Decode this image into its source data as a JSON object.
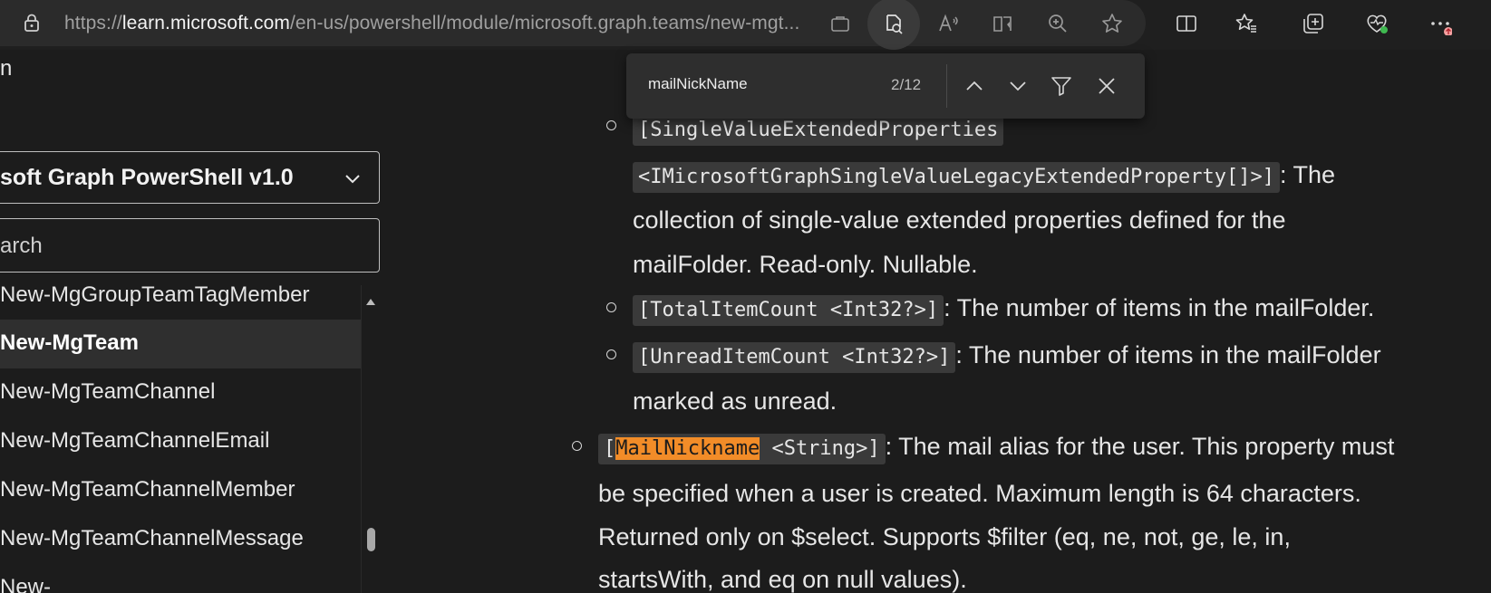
{
  "browser": {
    "url_prefix": "https://",
    "url_host": "learn.microsoft.com",
    "url_path": "/en-us/powershell/module/microsoft.graph.teams/new-mgt..."
  },
  "find": {
    "query": "mailNickName",
    "count": "2/12"
  },
  "sidebar": {
    "heading_partial": "n",
    "version": "soft Graph PowerShell v1.0",
    "search_placeholder": "arch",
    "items": [
      {
        "label": "New-MgGroupTeamTagMember",
        "selected": false
      },
      {
        "label": "New-MgTeam",
        "selected": true
      },
      {
        "label": "New-MgTeamChannel",
        "selected": false
      },
      {
        "label": "New-MgTeamChannelEmail",
        "selected": false
      },
      {
        "label": "New-MgTeamChannelMember",
        "selected": false
      },
      {
        "label": "New-MgTeamChannelMessage",
        "selected": false
      },
      {
        "label": "New-",
        "selected": false
      }
    ]
  },
  "content": {
    "p1_code_a": "[SingleValueExtendedProperties",
    "p1_code_b": "<IMicrosoftGraphSingleValueLegacyExtendedProperty[]>]",
    "p1_text_a": ": The",
    "p1_text_b": "collection of single-value extended properties defined for the",
    "p1_text_c": "mailFolder. Read-only. Nullable.",
    "p2_code": "[TotalItemCount <Int32?>]",
    "p2_text": ": The number of items in the mailFolder.",
    "p3_code": "[UnreadItemCount <Int32?>]",
    "p3_text_a": ": The number of items in the mailFolder",
    "p3_text_b": "marked as unread.",
    "p4_code_open": "[",
    "p4_code_match": "MailNickname",
    "p4_code_rest": " <String>]",
    "p4_text_a": ": The mail alias for the user. This property must",
    "p4_text_b": "be specified when a user is created. Maximum length is 64 characters.",
    "p4_text_c": "Returned only on $select. Supports $filter (eq, ne, not, ge, le, in,",
    "p4_text_d": "startsWith, and eq on null values)."
  },
  "colors": {
    "background": "#1c1c1c",
    "code_bg": "#3a3a3a",
    "match_highlight": "#f28c28",
    "selected_item": "#2f2f2f"
  },
  "icons": [
    "lock-icon",
    "tab-icon",
    "reader-view-icon",
    "read-aloud-icon",
    "immersive-reader-icon",
    "zoom-icon",
    "favorite-star-icon",
    "split-screen-icon",
    "favorites-icon",
    "collections-icon",
    "browser-essentials-icon",
    "more-icon",
    "chevron-up-icon",
    "chevron-down-icon",
    "filter-icon",
    "close-icon"
  ]
}
